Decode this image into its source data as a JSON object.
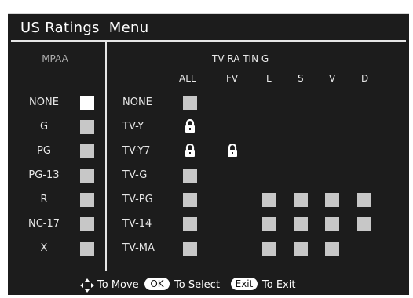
{
  "title": "US Ratings  Menu",
  "mpaa": {
    "heading": "MPAA",
    "items": [
      {
        "label": "NONE",
        "selected": true
      },
      {
        "label": "G",
        "selected": false
      },
      {
        "label": "PG",
        "selected": false
      },
      {
        "label": "PG-13",
        "selected": false
      },
      {
        "label": "R",
        "selected": false
      },
      {
        "label": "NC-17",
        "selected": false
      },
      {
        "label": "X",
        "selected": false
      }
    ]
  },
  "tv": {
    "heading": "TV RA TIN G",
    "columns": [
      "ALL",
      "FV",
      "L",
      "S",
      "V",
      "D"
    ],
    "rows": [
      {
        "label": "NONE",
        "cells": [
          "box",
          "",
          "",
          "",
          "",
          ""
        ]
      },
      {
        "label": "TV-Y",
        "cells": [
          "lock",
          "",
          "",
          "",
          "",
          ""
        ]
      },
      {
        "label": "TV-Y7",
        "cells": [
          "lock",
          "lock",
          "",
          "",
          "",
          ""
        ]
      },
      {
        "label": "TV-G",
        "cells": [
          "box",
          "",
          "",
          "",
          "",
          ""
        ]
      },
      {
        "label": "TV-PG",
        "cells": [
          "box",
          "",
          "box",
          "box",
          "box",
          "box"
        ]
      },
      {
        "label": "TV-14",
        "cells": [
          "box",
          "",
          "box",
          "box",
          "box",
          "box"
        ]
      },
      {
        "label": "TV-MA",
        "cells": [
          "box",
          "",
          "box",
          "box",
          "box",
          ""
        ]
      }
    ]
  },
  "footer": {
    "move_label": "To Move",
    "ok_key": "OK",
    "select_label": "To Select",
    "exit_key": "Exit",
    "exit_label": "To Exit"
  },
  "icons": {
    "move": "four-way-arrow-icon",
    "lock": "lock-icon"
  }
}
